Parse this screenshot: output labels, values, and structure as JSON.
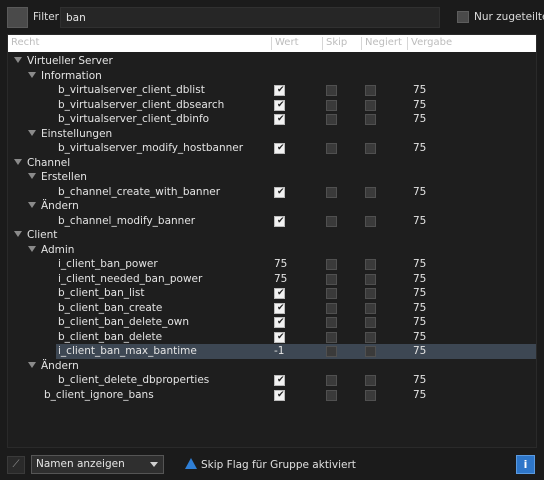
{
  "filter": {
    "label": "Filter:",
    "value": "ban"
  },
  "only_assigned": {
    "label": "Nur zugeteilte",
    "checked": false
  },
  "columns": {
    "recht": "Recht",
    "wert": "Wert",
    "skip": "Skip",
    "negiert": "Negiert",
    "vergabe": "Vergabe"
  },
  "rows": [
    {
      "kind": "group",
      "level": 0,
      "label": "Virtueller Server"
    },
    {
      "kind": "group",
      "level": 1,
      "label": "Information"
    },
    {
      "kind": "perm",
      "level": 2,
      "label": "b_virtualserver_client_dblist",
      "wert": "checked",
      "skip": false,
      "negiert": false,
      "vergabe": "75"
    },
    {
      "kind": "perm",
      "level": 2,
      "label": "b_virtualserver_client_dbsearch",
      "wert": "checked",
      "skip": false,
      "negiert": false,
      "vergabe": "75"
    },
    {
      "kind": "perm",
      "level": 2,
      "label": "b_virtualserver_client_dbinfo",
      "wert": "checked",
      "skip": false,
      "negiert": false,
      "vergabe": "75"
    },
    {
      "kind": "group",
      "level": 1,
      "label": "Einstellungen"
    },
    {
      "kind": "perm",
      "level": 2,
      "label": "b_virtualserver_modify_hostbanner",
      "wert": "checked",
      "skip": false,
      "negiert": false,
      "vergabe": "75"
    },
    {
      "kind": "group",
      "level": 0,
      "label": "Channel"
    },
    {
      "kind": "group",
      "level": 1,
      "label": "Erstellen"
    },
    {
      "kind": "perm",
      "level": 2,
      "label": "b_channel_create_with_banner",
      "wert": "checked",
      "skip": false,
      "negiert": false,
      "vergabe": "75"
    },
    {
      "kind": "group",
      "level": 1,
      "label": "Ändern"
    },
    {
      "kind": "perm",
      "level": 2,
      "label": "b_channel_modify_banner",
      "wert": "checked",
      "skip": false,
      "negiert": false,
      "vergabe": "75"
    },
    {
      "kind": "group",
      "level": 0,
      "label": "Client"
    },
    {
      "kind": "group",
      "level": 1,
      "label": "Admin"
    },
    {
      "kind": "perm",
      "level": 2,
      "label": "i_client_ban_power",
      "wert": "75",
      "skip": false,
      "negiert": false,
      "vergabe": "75"
    },
    {
      "kind": "perm",
      "level": 2,
      "label": "i_client_needed_ban_power",
      "wert": "75",
      "skip": false,
      "negiert": false,
      "vergabe": "75"
    },
    {
      "kind": "perm",
      "level": 2,
      "label": "b_client_ban_list",
      "wert": "checked",
      "skip": false,
      "negiert": false,
      "vergabe": "75"
    },
    {
      "kind": "perm",
      "level": 2,
      "label": "b_client_ban_create",
      "wert": "checked",
      "skip": false,
      "negiert": false,
      "vergabe": "75"
    },
    {
      "kind": "perm",
      "level": 2,
      "label": "b_client_ban_delete_own",
      "wert": "checked",
      "skip": false,
      "negiert": false,
      "vergabe": "75"
    },
    {
      "kind": "perm",
      "level": 2,
      "label": "b_client_ban_delete",
      "wert": "checked",
      "skip": false,
      "negiert": false,
      "vergabe": "75"
    },
    {
      "kind": "perm",
      "level": 2,
      "label": "i_client_ban_max_bantime",
      "wert": "-1",
      "skip": false,
      "negiert": false,
      "vergabe": "75",
      "selected": true
    },
    {
      "kind": "group",
      "level": 1,
      "label": "Ändern"
    },
    {
      "kind": "perm",
      "level": 2,
      "label": "b_client_delete_dbproperties",
      "wert": "checked",
      "skip": false,
      "negiert": false,
      "vergabe": "75"
    },
    {
      "kind": "perm",
      "level": 1,
      "label": "b_client_ignore_bans",
      "wert": "checked",
      "skip": false,
      "negiert": false,
      "vergabe": "75"
    }
  ],
  "bottom": {
    "display_select": "Namen anzeigen",
    "skip_notice": "Skip Flag für Gruppe aktiviert",
    "info_icon": "info-icon",
    "pin_icon": "pin-icon",
    "warn_icon": "warning-triangle-icon"
  },
  "colors": {
    "selection": "#3d4753",
    "accent": "#2e76c9"
  }
}
